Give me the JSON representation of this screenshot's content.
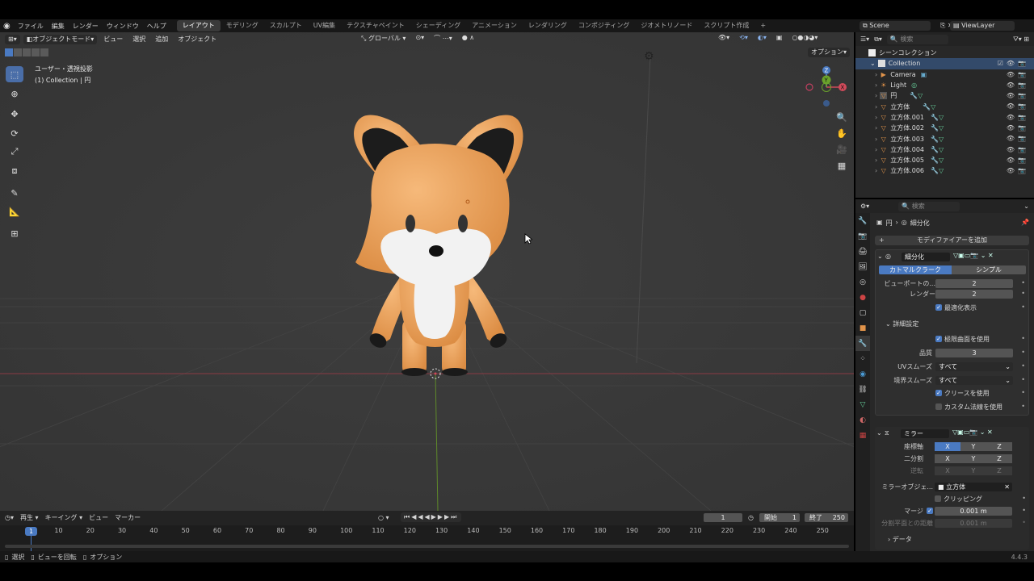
{
  "menus": [
    "ファイル",
    "編集",
    "レンダー",
    "ウィンドウ",
    "ヘルプ"
  ],
  "workspaces": [
    "レイアウト",
    "モデリング",
    "スカルプト",
    "UV編集",
    "テクスチャペイント",
    "シェーディング",
    "アニメーション",
    "レンダリング",
    "コンポジティング",
    "ジオメトリノード",
    "スクリプト作成"
  ],
  "active_workspace": "レイアウト",
  "add_workspace": "+",
  "scene": "Scene",
  "view_layer": "ViewLayer",
  "viewport": {
    "mode": "オブジェクトモード",
    "menu": [
      "ビュー",
      "選択",
      "追加",
      "オブジェクト"
    ],
    "transform": "グローバル",
    "options": "オプション",
    "info_line1": "ユーザー・透視投影",
    "info_line2": "(1) Collection | 円",
    "axes": {
      "z": "Z",
      "y": "Y",
      "x": "X"
    }
  },
  "outliner": {
    "search_placeholder": "検索",
    "scene_collection": "シーンコレクション",
    "collection": "Collection",
    "items": [
      "Camera",
      "Light",
      "円",
      "立方体",
      "立方体.001",
      "立方体.002",
      "立方体.003",
      "立方体.004",
      "立方体.005",
      "立方体.006"
    ]
  },
  "properties": {
    "search_placeholder": "検索",
    "breadcrumb_obj": "円",
    "breadcrumb_mod": "細分化",
    "add_modifier": "モディファイアーを追加",
    "subdiv": {
      "name": "細分化",
      "tab1": "カトマルクラーク",
      "tab2": "シンプル",
      "viewport_label": "ビューポートの...",
      "viewport_val": "2",
      "render_label": "レンダー",
      "render_val": "2",
      "optimal": "最適化表示",
      "advanced": "詳細設定",
      "limit": "極限曲面を使用",
      "quality_label": "品質",
      "quality_val": "3",
      "uv_label": "UVスムーズ",
      "uv_val": "すべて",
      "boundary_label": "境界スムーズ",
      "boundary_val": "すべて",
      "crease": "クリースを使用",
      "custom_normals": "カスタム法線を使用"
    },
    "mirror": {
      "name": "ミラー",
      "axis_label": "座標軸",
      "bisect_label": "二分割",
      "flip_label": "逆転",
      "x": "X",
      "y": "Y",
      "z": "Z",
      "mirror_obj_label": "ミラーオブジェ...",
      "mirror_obj": "立方体",
      "clipping": "クリッピング",
      "merge_label": "マージ",
      "merge_val": "0.001 m",
      "bisect_dist_label": "分割平面との距離",
      "bisect_dist_val": "0.001 m",
      "data": "データ"
    }
  },
  "timeline": {
    "menu": [
      "再生",
      "キーイング",
      "ビュー",
      "マーカー"
    ],
    "current": "1",
    "start_label": "開始",
    "start": "1",
    "end_label": "終了",
    "end": "250",
    "ticks": [
      "10",
      "20",
      "30",
      "40",
      "50",
      "60",
      "70",
      "80",
      "90",
      "100",
      "110",
      "120",
      "130",
      "140",
      "150",
      "160",
      "170",
      "180",
      "190",
      "200",
      "210",
      "220",
      "230",
      "240",
      "250"
    ],
    "frame_marker": "1"
  },
  "status": {
    "select": "選択",
    "rotate": "ビューを回転",
    "options": "オプション",
    "version": "4.4.3"
  },
  "colors": {
    "accent": "#4a7ac2",
    "viewport": "#3a3a3a",
    "panel": "#282828",
    "fox": "#e8a05a"
  }
}
